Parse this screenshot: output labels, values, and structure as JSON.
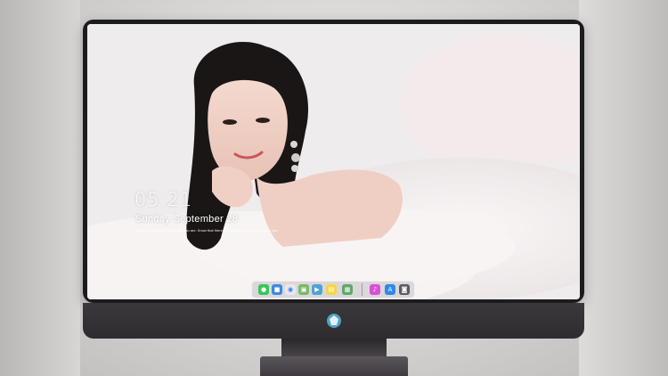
{
  "lockscreen": {
    "time": "05:21",
    "date": "Sunday September  28",
    "quote": "Believe in yourself and all that you are. Know that there is something inside you that is greater than any obstacle."
  },
  "dock": {
    "icons": [
      {
        "name": "messages-icon",
        "color": "#34c759",
        "glyph": "●"
      },
      {
        "name": "finder-icon",
        "color": "#3b8be0",
        "glyph": "■"
      },
      {
        "name": "safari-icon",
        "color": "#e8e8e8",
        "glyph": "◉"
      },
      {
        "name": "photos-icon",
        "color": "#7ab86a",
        "glyph": "▣"
      },
      {
        "name": "video-icon",
        "color": "#4da3d6",
        "glyph": "▶"
      },
      {
        "name": "notes-icon",
        "color": "#f5d547",
        "glyph": "▤"
      },
      {
        "name": "preview-icon",
        "color": "#5fa86b",
        "glyph": "▦"
      },
      {
        "name": "itunes-icon",
        "color": "#d94fd6",
        "glyph": "♪"
      },
      {
        "name": "appstore-icon",
        "color": "#2f89e8",
        "glyph": "A"
      },
      {
        "name": "camera-icon",
        "color": "#5e5b60",
        "glyph": "◙"
      }
    ]
  },
  "colors": {
    "bezel": "#1c1b1d",
    "chin": "#3b383c",
    "dock_bg": "#d2cdd2"
  }
}
